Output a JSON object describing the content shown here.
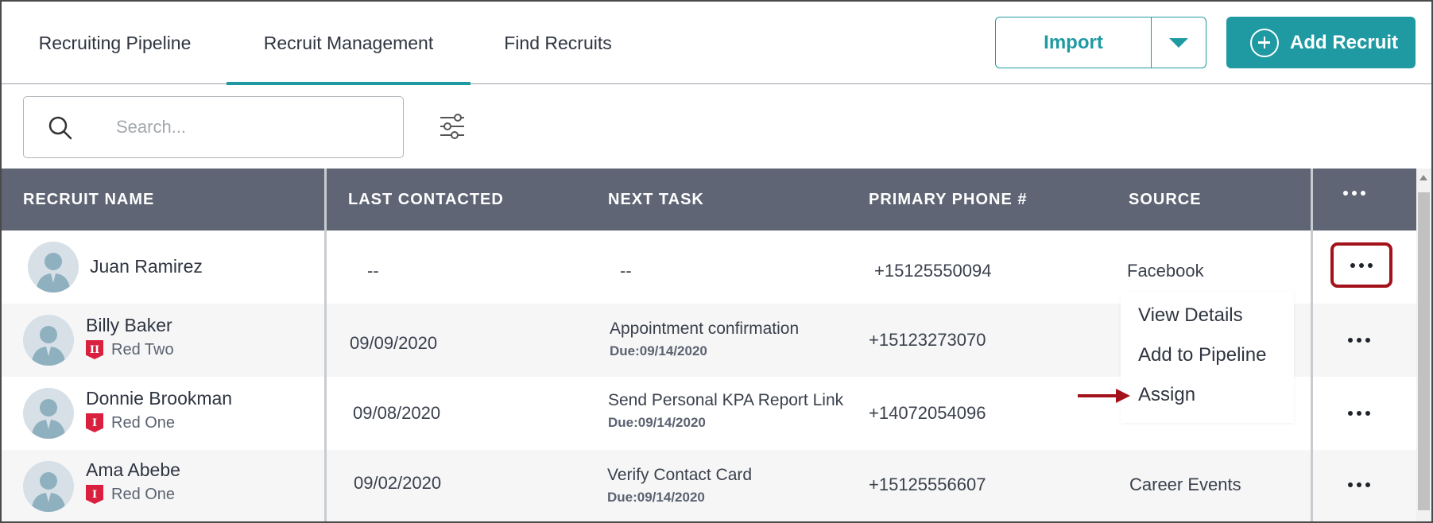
{
  "tabs": [
    {
      "label": "Recruiting Pipeline"
    },
    {
      "label": "Recruit Management"
    },
    {
      "label": "Find Recruits"
    }
  ],
  "actions": {
    "import_label": "Import",
    "add_label": "Add Recruit"
  },
  "search": {
    "placeholder": "Search..."
  },
  "table": {
    "columns": [
      "RECRUIT NAME",
      "LAST CONTACTED",
      "NEXT TASK",
      "PRIMARY PHONE #",
      "SOURCE"
    ],
    "rows": [
      {
        "name": "Juan Ramirez",
        "team": "",
        "last_contacted": "--",
        "task": "--",
        "due": "",
        "phone": "+15125550094",
        "source": "Facebook"
      },
      {
        "name": "Billy Baker",
        "team": "Red Two",
        "badge": "II",
        "last_contacted": "09/09/2020",
        "task": "Appointment confirmation",
        "due": "Due:09/14/2020",
        "phone": "+15123273070",
        "source": ""
      },
      {
        "name": "Donnie Brookman",
        "team": "Red One",
        "badge": "I",
        "last_contacted": "09/08/2020",
        "task": "Send Personal KPA Report Link",
        "due": "Due:09/14/2020",
        "phone": "+14072054096",
        "source": ""
      },
      {
        "name": "Ama Abebe",
        "team": "Red One",
        "badge": "I",
        "last_contacted": "09/02/2020",
        "task": "Verify Contact Card",
        "due": "Due:09/14/2020",
        "phone": "+15125556607",
        "source": "Career Events"
      }
    ]
  },
  "menu": {
    "items": [
      "View Details",
      "Add to Pipeline",
      "Assign"
    ]
  },
  "colors": {
    "accent": "#1f9aa3",
    "header": "#5f6574",
    "highlight": "#a3111a",
    "badge": "#d9213f"
  }
}
